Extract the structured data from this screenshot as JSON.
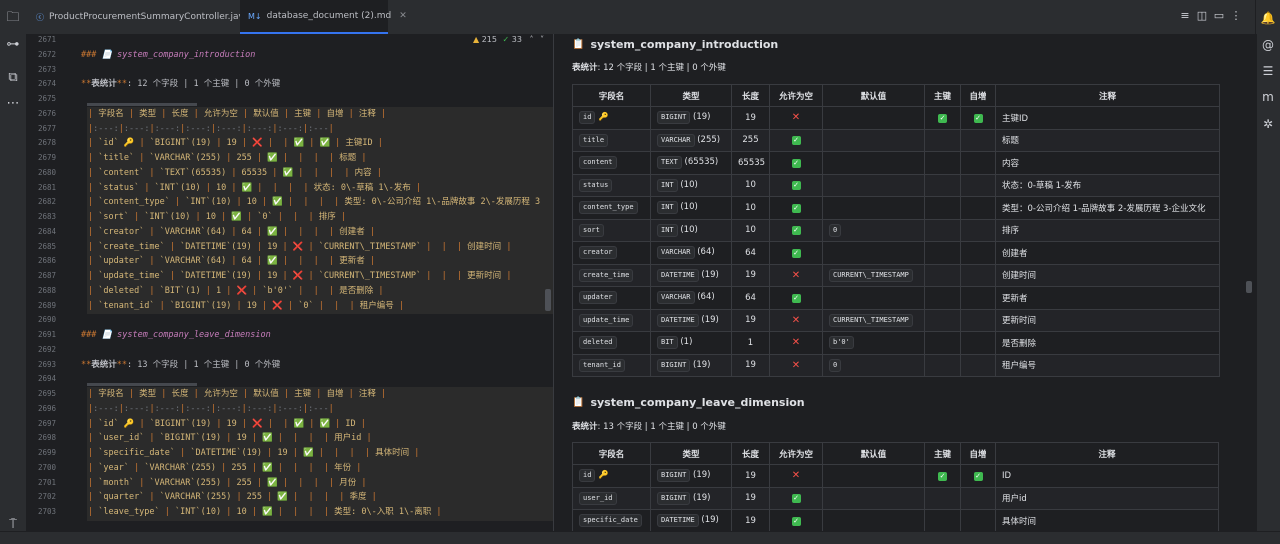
{
  "tabs": [
    {
      "label": "ProductProcurementSummaryController.java",
      "icon": "java-class-icon"
    },
    {
      "label": "database_document (2).md",
      "icon": "markdown-icon"
    }
  ],
  "editor": {
    "warning_count": "215",
    "check_count": "33",
    "line_numbers": [
      "2671",
      "2672",
      "2673",
      "2674",
      "2675",
      "2676",
      "2677",
      "2678",
      "2679",
      "2680",
      "2681",
      "2682",
      "2683",
      "2684",
      "2685",
      "2686",
      "2687",
      "2688",
      "2689",
      "2690",
      "2691",
      "2692",
      "2693",
      "2694",
      "2695",
      "2696",
      "2697",
      "2698",
      "2699",
      "2700",
      "2701",
      "2702",
      "2703"
    ],
    "lines": [
      "",
      "### 📄 system_company_introduction",
      "",
      "**表统计**: 12 个字段 | 1 个主键 | 0 个外键",
      "",
      "| 字段名 | 类型 | 长度 | 允许为空 | 默认值 | 主键 | 自增 | 注释 |",
      "|:---:|:---:|:---:|:---:|:---:|:---:|:---:|:---|",
      "| `id` 🔑 | `BIGINT`(19) | 19 | ❌ |  | ✅ | ✅ | 主键ID |",
      "| `title` | `VARCHAR`(255) | 255 | ✅ |  |  |  | 标题 |",
      "| `content` | `TEXT`(65535) | 65535 | ✅ |  |  |  | 内容 |",
      "| `status` | `INT`(10) | 10 | ✅ |  |  |  | 状态: 0\\-草稿 1\\-发布 |",
      "| `content_type` | `INT`(10) | 10 | ✅ |  |  |  | 类型: 0\\-公司介绍 1\\-品牌故事 2\\-发展历程 3",
      "| `sort` | `INT`(10) | 10 | ✅ | `0` |  |  | 排序 |",
      "| `creator` | `VARCHAR`(64) | 64 | ✅ |  |  |  | 创建者 |",
      "| `create_time` | `DATETIME`(19) | 19 | ❌ | `CURRENT\\_TIMESTAMP` |  |  | 创建时间 |",
      "| `updater` | `VARCHAR`(64) | 64 | ✅ |  |  |  | 更新者 |",
      "| `update_time` | `DATETIME`(19) | 19 | ❌ | `CURRENT\\_TIMESTAMP` |  |  | 更新时间 |",
      "| `deleted` | `BIT`(1) | 1 | ❌ | `b'0'` |  |  | 是否删除 |",
      "| `tenant_id` | `BIGINT`(19) | 19 | ❌ | `0` |  |  | 租户编号 |",
      "",
      "### 📄 system_company_leave_dimension",
      "",
      "**表统计**: 13 个字段 | 1 个主键 | 0 个外键",
      "",
      "| 字段名 | 类型 | 长度 | 允许为空 | 默认值 | 主键 | 自增 | 注释 |",
      "|:---:|:---:|:---:|:---:|:---:|:---:|:---:|:---|",
      "| `id` 🔑 | `BIGINT`(19) | 19 | ❌ |  | ✅ | ✅ | ID |",
      "| `user_id` | `BIGINT`(19) | 19 | ✅ |  |  |  | 用户id |",
      "| `specific_date` | `DATETIME`(19) | 19 | ✅ |  |  |  | 具体时间 |",
      "| `year` | `VARCHAR`(255) | 255 | ✅ |  |  |  | 年份 |",
      "| `month` | `VARCHAR`(255) | 255 | ✅ |  |  |  | 月份 |",
      "| `quarter` | `VARCHAR`(255) | 255 | ✅ |  |  |  | 季度 |",
      "| `leave_type` | `INT`(10) | 10 | ✅ |  |  |  | 类型: 0\\-入职 1\\-离职 |"
    ]
  },
  "preview": {
    "table1": {
      "title": "system_company_introduction",
      "stat_label": "表统计",
      "stat_rest": ": 12 个字段 | 1 个主键 | 0 个外键",
      "headers": [
        "字段名",
        "类型",
        "长度",
        "允许为空",
        "默认值",
        "主键",
        "自增",
        "注释"
      ],
      "rows": [
        {
          "name": "id",
          "key": true,
          "type": "BIGINT",
          "type_len": "(19)",
          "len": "19",
          "nullable": "no",
          "default": "",
          "pk": true,
          "ai": true,
          "comment": "主键ID"
        },
        {
          "name": "title",
          "key": false,
          "type": "VARCHAR",
          "type_len": "(255)",
          "len": "255",
          "nullable": "yes",
          "default": "",
          "pk": false,
          "ai": false,
          "comment": "标题"
        },
        {
          "name": "content",
          "key": false,
          "type": "TEXT",
          "type_len": "(65535)",
          "len": "65535",
          "nullable": "yes",
          "default": "",
          "pk": false,
          "ai": false,
          "comment": "内容"
        },
        {
          "name": "status",
          "key": false,
          "type": "INT",
          "type_len": "(10)",
          "len": "10",
          "nullable": "yes",
          "default": "",
          "pk": false,
          "ai": false,
          "comment": "状态：0-草稿 1-发布"
        },
        {
          "name": "content_type",
          "key": false,
          "type": "INT",
          "type_len": "(10)",
          "len": "10",
          "nullable": "yes",
          "default": "",
          "pk": false,
          "ai": false,
          "comment": "类型：0-公司介绍 1-品牌故事 2-发展历程 3-企业文化"
        },
        {
          "name": "sort",
          "key": false,
          "type": "INT",
          "type_len": "(10)",
          "len": "10",
          "nullable": "yes",
          "default": "0",
          "pk": false,
          "ai": false,
          "comment": "排序"
        },
        {
          "name": "creator",
          "key": false,
          "type": "VARCHAR",
          "type_len": "(64)",
          "len": "64",
          "nullable": "yes",
          "default": "",
          "pk": false,
          "ai": false,
          "comment": "创建者"
        },
        {
          "name": "create_time",
          "key": false,
          "type": "DATETIME",
          "type_len": "(19)",
          "len": "19",
          "nullable": "no",
          "default": "CURRENT\\_TIMESTAMP",
          "pk": false,
          "ai": false,
          "comment": "创建时间"
        },
        {
          "name": "updater",
          "key": false,
          "type": "VARCHAR",
          "type_len": "(64)",
          "len": "64",
          "nullable": "yes",
          "default": "",
          "pk": false,
          "ai": false,
          "comment": "更新者"
        },
        {
          "name": "update_time",
          "key": false,
          "type": "DATETIME",
          "type_len": "(19)",
          "len": "19",
          "nullable": "no",
          "default": "CURRENT\\_TIMESTAMP",
          "pk": false,
          "ai": false,
          "comment": "更新时间"
        },
        {
          "name": "deleted",
          "key": false,
          "type": "BIT",
          "type_len": "(1)",
          "len": "1",
          "nullable": "no",
          "default": "b'0'",
          "pk": false,
          "ai": false,
          "comment": "是否删除"
        },
        {
          "name": "tenant_id",
          "key": false,
          "type": "BIGINT",
          "type_len": "(19)",
          "len": "19",
          "nullable": "no",
          "default": "0",
          "pk": false,
          "ai": false,
          "comment": "租户编号"
        }
      ]
    },
    "table2": {
      "title": "system_company_leave_dimension",
      "stat_label": "表统计",
      "stat_rest": ": 13 个字段 | 1 个主键 | 0 个外键",
      "headers": [
        "字段名",
        "类型",
        "长度",
        "允许为空",
        "默认值",
        "主键",
        "自增",
        "注释"
      ],
      "rows": [
        {
          "name": "id",
          "key": true,
          "type": "BIGINT",
          "type_len": "(19)",
          "len": "19",
          "nullable": "no",
          "default": "",
          "pk": true,
          "ai": true,
          "comment": "ID"
        },
        {
          "name": "user_id",
          "key": false,
          "type": "BIGINT",
          "type_len": "(19)",
          "len": "19",
          "nullable": "yes",
          "default": "",
          "pk": false,
          "ai": false,
          "comment": "用户id"
        },
        {
          "name": "specific_date",
          "key": false,
          "type": "DATETIME",
          "type_len": "(19)",
          "len": "19",
          "nullable": "yes",
          "default": "",
          "pk": false,
          "ai": false,
          "comment": "具体时间"
        }
      ]
    }
  }
}
